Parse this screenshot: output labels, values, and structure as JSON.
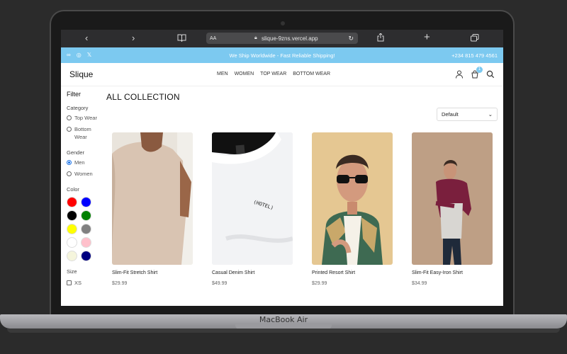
{
  "browser": {
    "text_size_label": "AA",
    "url": "slique-9zns.vercel.app"
  },
  "announcement": {
    "message": "We Ship Worldwide - Fast Reliable Shipping!",
    "phone": "+234 815 479 4561"
  },
  "header": {
    "logo": "Slique",
    "nav": [
      "MEN",
      "WOMEN",
      "TOP WEAR",
      "BOTTOM WEAR"
    ],
    "cart_count": "1"
  },
  "filter": {
    "title": "Filter",
    "category": {
      "label": "Category",
      "options": [
        "Top Wear",
        "Bottom Wear"
      ]
    },
    "gender": {
      "label": "Gender",
      "options": [
        "Men",
        "Women"
      ],
      "selected": "Men"
    },
    "color": {
      "label": "Color",
      "swatches": [
        "#ff0000",
        "#0000ff",
        "#000000",
        "#008000",
        "#ffff00",
        "#808080",
        "#ffffff",
        "#ffc0cb",
        "#f5f5dc",
        "#000080"
      ]
    },
    "size": {
      "label": "Size",
      "options": [
        "XS"
      ]
    }
  },
  "main": {
    "title": "ALL COLLECTION",
    "sort_value": "Default"
  },
  "products": [
    {
      "name": "Slim-Fit Stretch Shirt",
      "price": "$29.99"
    },
    {
      "name": "Casual Denim Shirt",
      "price": "$49.99"
    },
    {
      "name": "Printed Resort Shirt",
      "price": "$29.99"
    },
    {
      "name": "Slim-Fit Easy-Iron Shirt",
      "price": "$34.99"
    }
  ],
  "device": {
    "label": "MacBook Air"
  }
}
